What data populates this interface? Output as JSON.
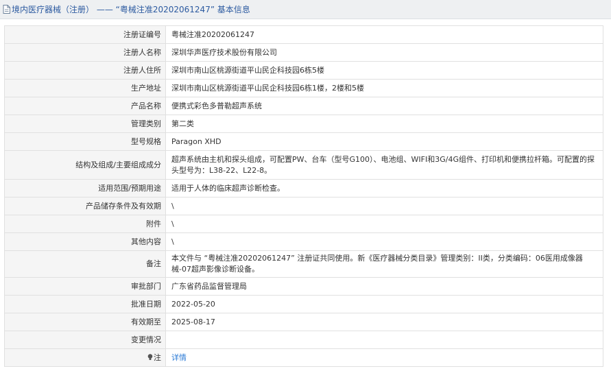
{
  "header": {
    "title": "境内医疗器械（注册） —— “粤械注准20202061247” 基本信息"
  },
  "rows": [
    {
      "label": "注册证编号",
      "value": "粤械注准20202061247"
    },
    {
      "label": "注册人名称",
      "value": "深圳华声医疗技术股份有限公司"
    },
    {
      "label": "注册人住所",
      "value": "深圳市南山区桃源街道平山民企科技园6栋5楼"
    },
    {
      "label": "生产地址",
      "value": "深圳市南山区桃源街道平山民企科技园6栋1楼，2楼和5楼"
    },
    {
      "label": "产品名称",
      "value": "便携式彩色多普勒超声系统"
    },
    {
      "label": "管理类别",
      "value": "第二类"
    },
    {
      "label": "型号规格",
      "value": "Paragon XHD"
    },
    {
      "label": "结构及组成/主要组成成分",
      "value": "超声系统由主机和探头组成，可配置PW、台车（型号G100）、电池组、WIFI和3G/4G组件、打印机和便携拉杆箱。可配置的探头型号为：L38-22、L22-8。"
    },
    {
      "label": "适用范围/预期用途",
      "value": "适用于人体的临床超声诊断检查。"
    },
    {
      "label": "产品储存条件及有效期",
      "value": "\\"
    },
    {
      "label": "附件",
      "value": "\\"
    },
    {
      "label": "其他内容",
      "value": "\\"
    },
    {
      "label": "备注",
      "value": "本文件与 “粤械注准20202061247” 注册证共同使用。新《医疗器械分类目录》管理类别：II类，分类编码：06医用成像器械-07超声影像诊断设备。"
    },
    {
      "label": "审批部门",
      "value": "广东省药品监督管理局"
    },
    {
      "label": "批准日期",
      "value": "2022-05-20"
    },
    {
      "label": "有效期至",
      "value": "2025-08-17"
    },
    {
      "label": "变更情况",
      "value": ""
    }
  ],
  "note": {
    "label": "注",
    "link_text": "详情"
  }
}
